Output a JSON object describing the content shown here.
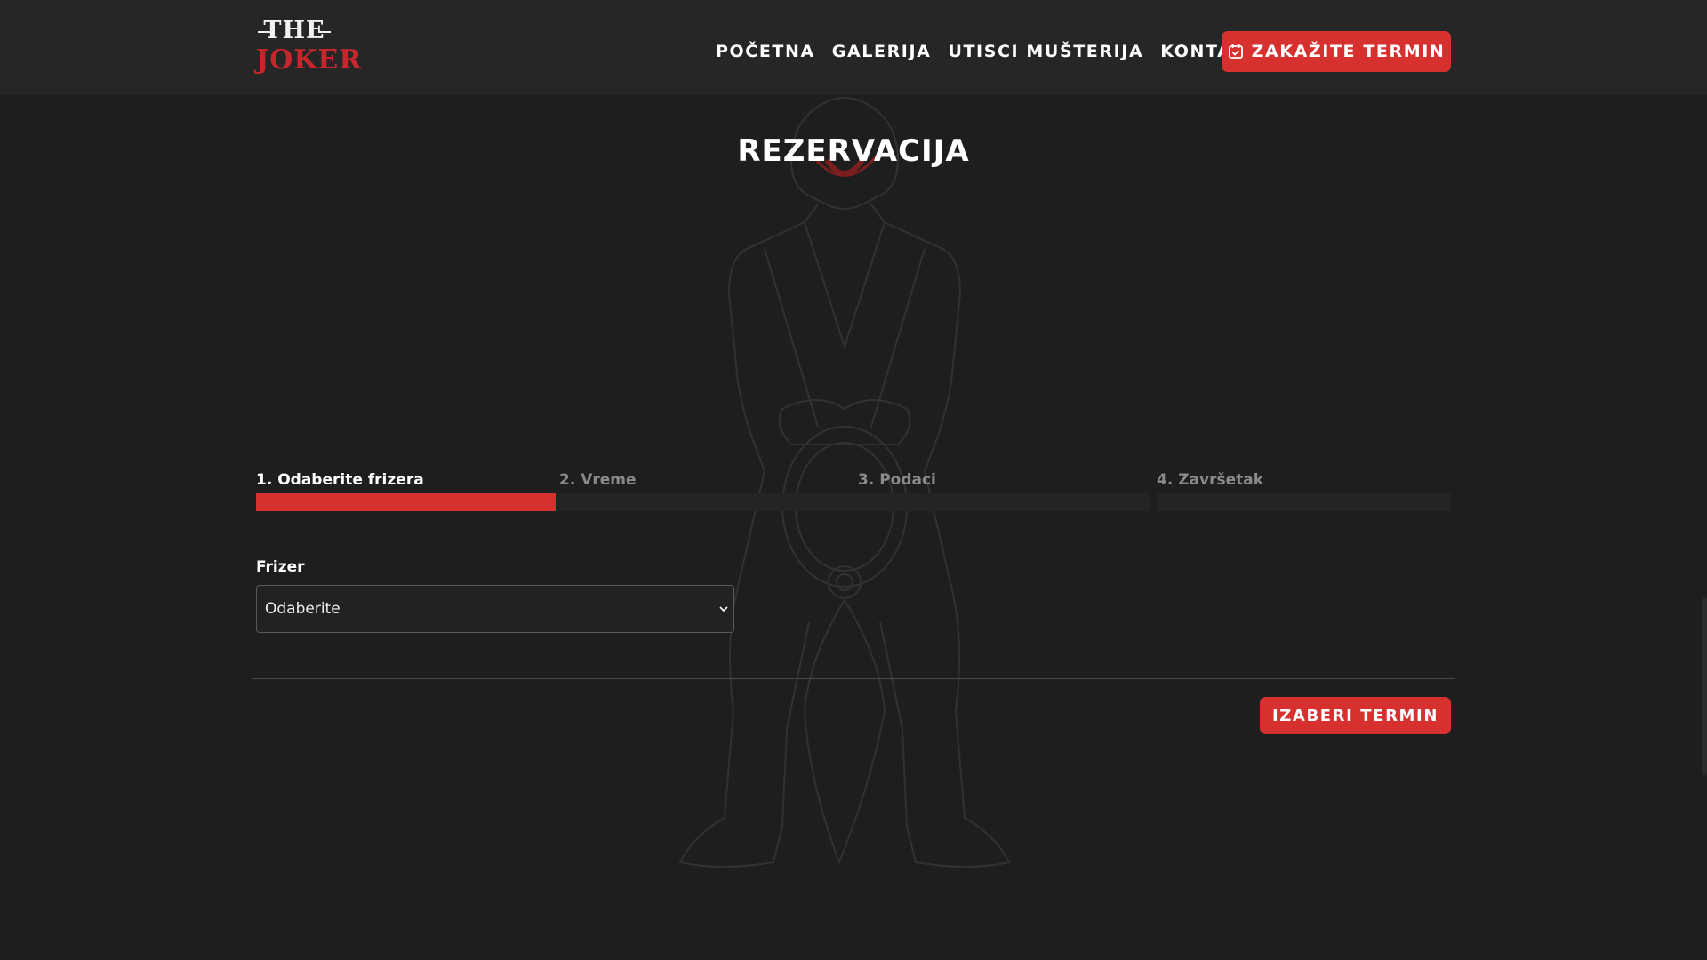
{
  "logo": {
    "line1": "THE",
    "line2": "JOKER"
  },
  "nav": {
    "links": [
      {
        "label": "POČETNA"
      },
      {
        "label": "GALERIJA"
      },
      {
        "label": "UTISCI MUŠTERIJA"
      },
      {
        "label": "KONTAKT"
      }
    ],
    "cta_label": "ZAKAŽITE TERMIN",
    "cta_icon": "calendar-check-icon"
  },
  "page_title": "REZERVACIJA",
  "steps": [
    {
      "label": "1. Odaberite frizera",
      "state": "active"
    },
    {
      "label": "2. Vreme",
      "state": "inactive"
    },
    {
      "label": "3. Podaci",
      "state": "inactive"
    },
    {
      "label": "4. Završetak",
      "state": "inactive"
    }
  ],
  "form": {
    "barber_label": "Frizer",
    "barber_value": "Odaberite"
  },
  "submit_label": "IZABERI TERMIN",
  "colors": {
    "accent": "#d6312e",
    "background": "#1e1e1e",
    "navbar": "#262626"
  }
}
